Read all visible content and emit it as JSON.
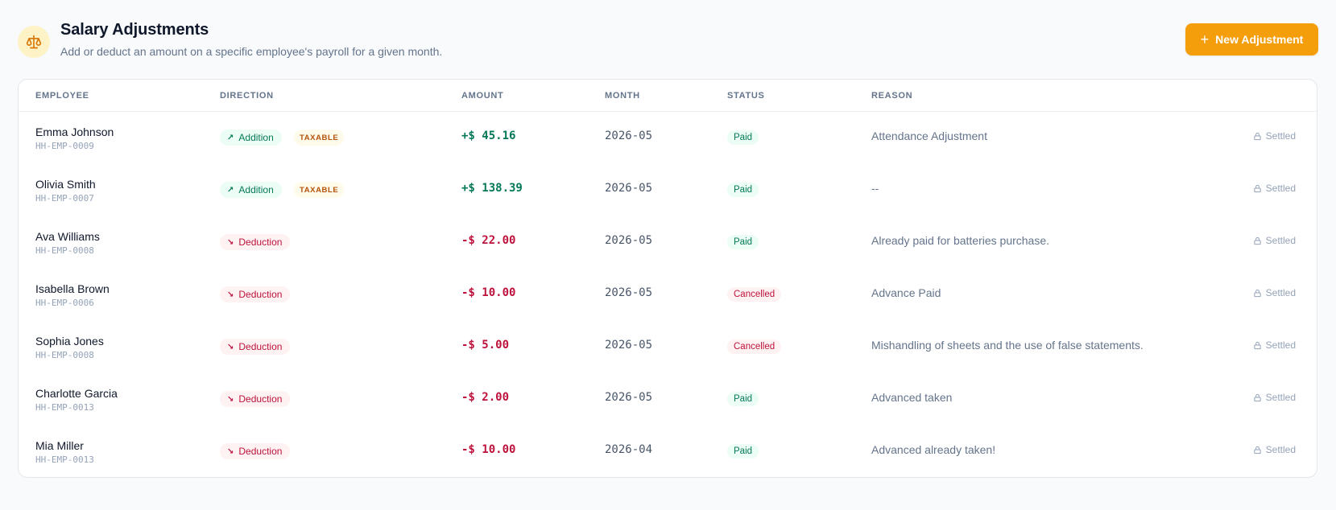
{
  "header": {
    "title": "Salary Adjustments",
    "subtitle": "Add or deduct an amount on a specific employee's payroll for a given month.",
    "icon": "scale-icon",
    "new_button": "New Adjustment"
  },
  "colors": {
    "accent": "#f59e0b",
    "addition": "#047857",
    "deduction": "#be123c",
    "taxable": "#b45309"
  },
  "table": {
    "headers": {
      "employee": "EMPLOYEE",
      "direction": "DIRECTION",
      "amount": "AMOUNT",
      "month": "MONTH",
      "status": "STATUS",
      "reason": "REASON"
    },
    "rows": [
      {
        "name": "Emma Johnson",
        "id": "HH-EMP-0009",
        "direction": "Addition",
        "taxable": "TAXABLE",
        "amount": "+$ 45.16",
        "month": "2026-05",
        "status": "Paid",
        "reason": "Attendance Adjustment",
        "action": "Settled"
      },
      {
        "name": "Olivia Smith",
        "id": "HH-EMP-0007",
        "direction": "Addition",
        "taxable": "TAXABLE",
        "amount": "+$ 138.39",
        "month": "2026-05",
        "status": "Paid",
        "reason": "--",
        "action": "Settled"
      },
      {
        "name": "Ava Williams",
        "id": "HH-EMP-0008",
        "direction": "Deduction",
        "taxable": "",
        "amount": "-$ 22.00",
        "month": "2026-05",
        "status": "Paid",
        "reason": "Already paid for batteries purchase.",
        "action": "Settled"
      },
      {
        "name": "Isabella Brown",
        "id": "HH-EMP-0006",
        "direction": "Deduction",
        "taxable": "",
        "amount": "-$ 10.00",
        "month": "2026-05",
        "status": "Cancelled",
        "reason": "Advance Paid",
        "action": "Settled"
      },
      {
        "name": "Sophia Jones",
        "id": "HH-EMP-0008",
        "direction": "Deduction",
        "taxable": "",
        "amount": "-$ 5.00",
        "month": "2026-05",
        "status": "Cancelled",
        "reason": "Mishandling of sheets and the use of false statements.",
        "action": "Settled"
      },
      {
        "name": "Charlotte Garcia",
        "id": "HH-EMP-0013",
        "direction": "Deduction",
        "taxable": "",
        "amount": "-$ 2.00",
        "month": "2026-05",
        "status": "Paid",
        "reason": "Advanced taken",
        "action": "Settled"
      },
      {
        "name": "Mia Miller",
        "id": "HH-EMP-0013",
        "direction": "Deduction",
        "taxable": "",
        "amount": "-$ 10.00",
        "month": "2026-04",
        "status": "Paid",
        "reason": "Advanced already taken!",
        "action": "Settled"
      }
    ]
  }
}
